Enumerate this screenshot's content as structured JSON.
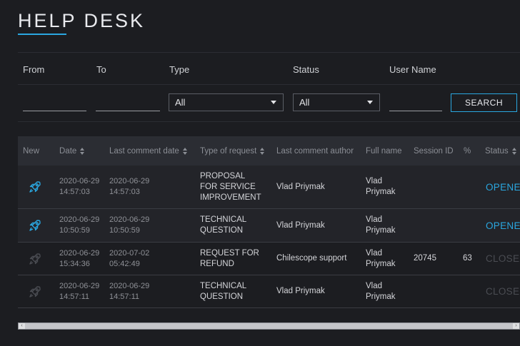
{
  "header": {
    "title": "HELP DESK"
  },
  "filters": {
    "from_label": "From",
    "to_label": "To",
    "type_label": "Type",
    "status_label": "Status",
    "username_label": "User Name",
    "type_value": "All",
    "status_value": "All",
    "search_label": "SEARCH"
  },
  "colors": {
    "accent": "#2aa7e0",
    "background": "#1c1d21",
    "header_bg": "#2b2d33",
    "closed": "#4a4c52"
  },
  "table": {
    "columns": [
      "New",
      "Date",
      "Last comment date",
      "Type of request",
      "Last comment author",
      "Full name",
      "Session ID",
      "%",
      "Status"
    ],
    "rows": [
      {
        "new_icon": "rocket-icon-blue",
        "date": "2020-06-29",
        "date_time": "14:57:03",
        "last_date": "2020-06-29",
        "last_time": "14:57:03",
        "type": "PROPOSAL FOR SERVICE IMPROVEMENT",
        "author": "Vlad Priymak",
        "full_name": "Vlad Priymak",
        "session_id": "",
        "percent": "",
        "status": "OPENED"
      },
      {
        "new_icon": "rocket-icon-blue",
        "date": "2020-06-29",
        "date_time": "10:50:59",
        "last_date": "2020-06-29",
        "last_time": "10:50:59",
        "type": "TECHNICAL QUESTION",
        "author": "Vlad Priymak",
        "full_name": "Vlad Priymak",
        "session_id": "",
        "percent": "",
        "status": "OPENED"
      },
      {
        "new_icon": "rocket-icon-gray",
        "date": "2020-06-29",
        "date_time": "15:34:36",
        "last_date": "2020-07-02",
        "last_time": "05:42:49",
        "type": "REQUEST FOR REFUND",
        "author": "Chilescope support",
        "full_name": "Vlad Priymak",
        "session_id": "20745",
        "percent": "63",
        "status": "CLOSED"
      },
      {
        "new_icon": "rocket-icon-gray",
        "date": "2020-06-29",
        "date_time": "14:57:11",
        "last_date": "2020-06-29",
        "last_time": "14:57:11",
        "type": "TECHNICAL QUESTION",
        "author": "Vlad Priymak",
        "full_name": "Vlad Priymak",
        "session_id": "",
        "percent": "",
        "status": "CLOSED"
      }
    ]
  }
}
